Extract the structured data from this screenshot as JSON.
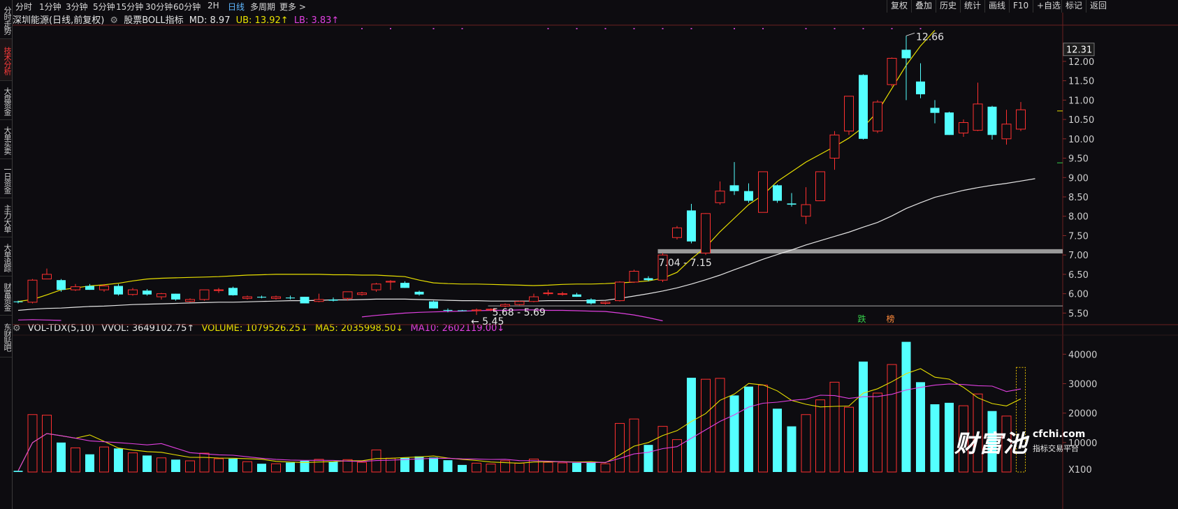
{
  "sidebar": {
    "tabs": [
      {
        "label": "分时走势",
        "active": false
      },
      {
        "label": "技术分析",
        "active": true
      },
      {
        "label": "大盘资金",
        "active": false
      },
      {
        "label": "大单买卖",
        "active": false
      },
      {
        "label": "一日资金",
        "active": false
      },
      {
        "label": "主力大单",
        "active": false
      },
      {
        "label": "大单追踪",
        "active": false
      },
      {
        "label": "财富资金",
        "active": false
      },
      {
        "label": "东财贴吧",
        "active": false
      }
    ]
  },
  "toolbar": {
    "periods": [
      "分时",
      "1分钟",
      "3分钟",
      "5分钟",
      "15分钟",
      "30分钟",
      "60分钟",
      "2H",
      "日线",
      "多周期",
      "更多 >"
    ],
    "active_period": "日线",
    "right_buttons": [
      "复权",
      "叠加",
      "历史",
      "统计",
      "画线",
      "F10",
      "+自选",
      "标记",
      "返回"
    ]
  },
  "indicator_line": {
    "stock": "深圳能源(日线,前复权)",
    "indicator": "股票BOLL指标",
    "md": "MD: 8.97",
    "ub": "UB: 13.92↑",
    "lb": "LB: 3.83↑",
    "colors": {
      "md": "#e6e6e6",
      "ub": "#e8e000",
      "lb": "#e040e0"
    }
  },
  "volume_line": {
    "name": "VOL-TDX(5,10)",
    "vvol": "VVOL: 3649102.75↑",
    "volume": "VOLUME: 1079526.25↓",
    "ma5": "MA5: 2035998.50↓",
    "ma10": "MA10: 2602119.00↓"
  },
  "price_axis": {
    "ticks": [
      "12.00",
      "11.50",
      "11.00",
      "10.50",
      "10.00",
      "9.50",
      "9.00",
      "8.50",
      "8.00",
      "7.50",
      "7.00",
      "6.50",
      "6.00",
      "5.50"
    ],
    "current_price_label": "12.31"
  },
  "volume_axis": {
    "ticks": [
      "40000",
      "30000",
      "20000",
      "10000"
    ],
    "unit": "X100"
  },
  "annotations": {
    "high": "12.66",
    "low": "5.45",
    "gap_top": "7.04 - 7.15",
    "gap_bottom": "5.68 - 5.69",
    "badge_die": "跌",
    "badge_bang": "榜"
  },
  "watermark": {
    "brand": "财富池",
    "site": "cfchi.com",
    "tagline": "指标交易平台"
  },
  "colors": {
    "up": "#ff3030",
    "down": "#54ffff",
    "ma5": "#e8e000",
    "ma10": "#e040e0",
    "bg": "#0d0c10"
  },
  "chart_data": {
    "type": "candlestick",
    "title": "深圳能源(日线,前复权)",
    "ylim": [
      5.2,
      12.9
    ],
    "candles": [
      {
        "o": 5.8,
        "h": 5.82,
        "l": 5.75,
        "c": 5.78,
        "v": 400
      },
      {
        "o": 5.78,
        "h": 6.38,
        "l": 5.75,
        "c": 6.35,
        "v": 19500
      },
      {
        "o": 6.38,
        "h": 6.65,
        "l": 6.38,
        "c": 6.5,
        "v": 19300
      },
      {
        "o": 6.35,
        "h": 6.38,
        "l": 6.05,
        "c": 6.1,
        "v": 10000
      },
      {
        "o": 6.1,
        "h": 6.25,
        "l": 6.07,
        "c": 6.18,
        "v": 8200
      },
      {
        "o": 6.2,
        "h": 6.25,
        "l": 6.1,
        "c": 6.1,
        "v": 6000
      },
      {
        "o": 6.1,
        "h": 6.25,
        "l": 6.05,
        "c": 6.2,
        "v": 8500
      },
      {
        "o": 6.2,
        "h": 6.25,
        "l": 5.95,
        "c": 5.98,
        "v": 8000
      },
      {
        "o": 5.98,
        "h": 6.15,
        "l": 5.95,
        "c": 6.1,
        "v": 6500
      },
      {
        "o": 6.08,
        "h": 6.12,
        "l": 5.95,
        "c": 5.98,
        "v": 5600
      },
      {
        "o": 5.92,
        "h": 6.02,
        "l": 5.85,
        "c": 6.0,
        "v": 4800
      },
      {
        "o": 6.0,
        "h": 6.0,
        "l": 5.82,
        "c": 5.85,
        "v": 4200
      },
      {
        "o": 5.8,
        "h": 5.88,
        "l": 5.78,
        "c": 5.85,
        "v": 3800
      },
      {
        "o": 5.85,
        "h": 6.1,
        "l": 5.82,
        "c": 6.1,
        "v": 6400
      },
      {
        "o": 6.1,
        "h": 6.15,
        "l": 6.02,
        "c": 6.1,
        "v": 4500
      },
      {
        "o": 6.15,
        "h": 6.18,
        "l": 5.95,
        "c": 5.96,
        "v": 4500
      },
      {
        "o": 5.88,
        "h": 5.95,
        "l": 5.85,
        "c": 5.92,
        "v": 3500
      },
      {
        "o": 5.92,
        "h": 5.95,
        "l": 5.88,
        "c": 5.9,
        "v": 2800
      },
      {
        "o": 5.88,
        "h": 5.95,
        "l": 5.85,
        "c": 5.92,
        "v": 2800
      },
      {
        "o": 5.9,
        "h": 5.95,
        "l": 5.85,
        "c": 5.88,
        "v": 3200
      },
      {
        "o": 5.92,
        "h": 5.92,
        "l": 5.75,
        "c": 5.75,
        "v": 3800
      },
      {
        "o": 5.8,
        "h": 6.0,
        "l": 5.78,
        "c": 5.85,
        "v": 4300
      },
      {
        "o": 5.85,
        "h": 5.9,
        "l": 5.8,
        "c": 5.82,
        "v": 3500
      },
      {
        "o": 5.88,
        "h": 6.05,
        "l": 5.82,
        "c": 6.05,
        "v": 4200
      },
      {
        "o": 5.98,
        "h": 6.05,
        "l": 5.95,
        "c": 6.02,
        "v": 3300
      },
      {
        "o": 6.1,
        "h": 6.28,
        "l": 6.05,
        "c": 6.25,
        "v": 7500
      },
      {
        "o": 6.3,
        "h": 6.35,
        "l": 6.1,
        "c": 6.32,
        "v": 4700
      },
      {
        "o": 6.28,
        "h": 6.32,
        "l": 6.15,
        "c": 6.15,
        "v": 4800
      },
      {
        "o": 6.05,
        "h": 6.08,
        "l": 5.95,
        "c": 5.98,
        "v": 5300
      },
      {
        "o": 5.8,
        "h": 5.82,
        "l": 5.62,
        "c": 5.62,
        "v": 4900
      },
      {
        "o": 5.58,
        "h": 5.62,
        "l": 5.52,
        "c": 5.56,
        "v": 4000
      },
      {
        "o": 5.57,
        "h": 5.58,
        "l": 5.55,
        "c": 5.56,
        "v": 2400
      },
      {
        "o": 5.56,
        "h": 5.62,
        "l": 5.45,
        "c": 5.58,
        "v": 3000
      },
      {
        "o": 5.58,
        "h": 5.62,
        "l": 5.55,
        "c": 5.6,
        "v": 2700
      },
      {
        "o": 5.68,
        "h": 5.75,
        "l": 5.65,
        "c": 5.72,
        "v": 3800
      },
      {
        "o": 5.72,
        "h": 5.82,
        "l": 5.7,
        "c": 5.8,
        "v": 3000
      },
      {
        "o": 5.8,
        "h": 6.0,
        "l": 5.78,
        "c": 5.92,
        "v": 4400
      },
      {
        "o": 6.0,
        "h": 6.1,
        "l": 5.95,
        "c": 6.02,
        "v": 3300
      },
      {
        "o": 6.0,
        "h": 6.05,
        "l": 5.95,
        "c": 6.0,
        "v": 3100
      },
      {
        "o": 5.98,
        "h": 6.02,
        "l": 5.92,
        "c": 5.92,
        "v": 3100
      },
      {
        "o": 5.85,
        "h": 5.88,
        "l": 5.72,
        "c": 5.75,
        "v": 3500
      },
      {
        "o": 5.75,
        "h": 5.8,
        "l": 5.72,
        "c": 5.78,
        "v": 2800
      },
      {
        "o": 5.82,
        "h": 6.32,
        "l": 5.8,
        "c": 6.3,
        "v": 16500
      },
      {
        "o": 6.3,
        "h": 6.62,
        "l": 6.28,
        "c": 6.58,
        "v": 18000
      },
      {
        "o": 6.4,
        "h": 6.45,
        "l": 6.32,
        "c": 6.35,
        "v": 9200
      },
      {
        "o": 6.35,
        "h": 7.05,
        "l": 6.3,
        "c": 7.0,
        "v": 15500
      },
      {
        "o": 7.45,
        "h": 7.75,
        "l": 7.4,
        "c": 7.7,
        "v": 11000
      },
      {
        "o": 8.15,
        "h": 8.32,
        "l": 7.3,
        "c": 7.35,
        "v": 32000
      },
      {
        "o": 7.05,
        "h": 8.08,
        "l": 7.0,
        "c": 8.07,
        "v": 31500
      },
      {
        "o": 8.35,
        "h": 8.9,
        "l": 8.3,
        "c": 8.65,
        "v": 31800
      },
      {
        "o": 8.8,
        "h": 9.4,
        "l": 8.55,
        "c": 8.65,
        "v": 26000
      },
      {
        "o": 8.65,
        "h": 8.85,
        "l": 8.35,
        "c": 8.4,
        "v": 29000
      },
      {
        "o": 8.1,
        "h": 9.15,
        "l": 8.1,
        "c": 9.15,
        "v": 29500
      },
      {
        "o": 8.8,
        "h": 8.82,
        "l": 8.35,
        "c": 8.4,
        "v": 21500
      },
      {
        "o": 8.33,
        "h": 8.6,
        "l": 8.25,
        "c": 8.3,
        "v": 15500
      },
      {
        "o": 8.0,
        "h": 8.75,
        "l": 7.8,
        "c": 8.3,
        "v": 19500
      },
      {
        "o": 8.4,
        "h": 9.15,
        "l": 8.4,
        "c": 9.15,
        "v": 24500
      },
      {
        "o": 9.5,
        "h": 10.2,
        "l": 9.2,
        "c": 10.1,
        "v": 30500
      },
      {
        "o": 10.2,
        "h": 11.1,
        "l": 10.1,
        "c": 11.1,
        "v": 22000
      },
      {
        "o": 11.65,
        "h": 11.67,
        "l": 9.98,
        "c": 10.0,
        "v": 37500
      },
      {
        "o": 10.2,
        "h": 11.0,
        "l": 10.15,
        "c": 10.95,
        "v": 26800
      },
      {
        "o": 11.4,
        "h": 12.1,
        "l": 11.35,
        "c": 12.08,
        "v": 36500
      },
      {
        "o": 12.3,
        "h": 12.66,
        "l": 11.0,
        "c": 12.08,
        "v": 44200
      },
      {
        "o": 11.48,
        "h": 11.95,
        "l": 11.05,
        "c": 11.15,
        "v": 30500
      },
      {
        "o": 10.8,
        "h": 11.0,
        "l": 10.4,
        "c": 10.67,
        "v": 23000
      },
      {
        "o": 10.68,
        "h": 10.7,
        "l": 10.1,
        "c": 10.1,
        "v": 23500
      },
      {
        "o": 10.15,
        "h": 10.5,
        "l": 10.05,
        "c": 10.42,
        "v": 22500
      },
      {
        "o": 10.22,
        "h": 11.45,
        "l": 10.2,
        "c": 10.9,
        "v": 26500
      },
      {
        "o": 10.83,
        "h": 10.85,
        "l": 9.98,
        "c": 10.1,
        "v": 20700
      },
      {
        "o": 10.0,
        "h": 10.75,
        "l": 9.85,
        "c": 10.38,
        "v": 19000
      },
      {
        "o": 10.25,
        "h": 10.95,
        "l": 10.2,
        "c": 10.75,
        "v": 35500
      }
    ],
    "boll": {
      "md": [
        5.57,
        5.6,
        5.62,
        5.63,
        5.65,
        5.67,
        5.68,
        5.7,
        5.72,
        5.73,
        5.74,
        5.75,
        5.76,
        5.77,
        5.78,
        5.78,
        5.79,
        5.8,
        5.81,
        5.82,
        5.82,
        5.83,
        5.84,
        5.84,
        5.85,
        5.86,
        5.86,
        5.86,
        5.85,
        5.84,
        5.83,
        5.82,
        5.82,
        5.81,
        5.81,
        5.81,
        5.81,
        5.82,
        5.82,
        5.82,
        5.82,
        5.83,
        5.88,
        5.94,
        6.0,
        6.07,
        6.15,
        6.25,
        6.36,
        6.48,
        6.62,
        6.75,
        6.89,
        7.01,
        7.13,
        7.26,
        7.37,
        7.48,
        7.59,
        7.72,
        7.84,
        8.01,
        8.2,
        8.35,
        8.49,
        8.58,
        8.67,
        8.74,
        8.8,
        8.85,
        8.91,
        8.97
      ],
      "ub": [
        5.8,
        5.85,
        5.97,
        6.1,
        6.15,
        6.2,
        6.23,
        6.27,
        6.33,
        6.38,
        6.4,
        6.41,
        6.42,
        6.43,
        6.44,
        6.46,
        6.48,
        6.49,
        6.5,
        6.5,
        6.5,
        6.5,
        6.49,
        6.49,
        6.48,
        6.48,
        6.46,
        6.44,
        6.35,
        6.28,
        6.26,
        6.25,
        6.25,
        6.24,
        6.23,
        6.22,
        6.21,
        6.22,
        6.24,
        6.25,
        6.25,
        6.26,
        6.28,
        6.3,
        6.33,
        6.4,
        6.55,
        6.9,
        7.2,
        7.6,
        7.95,
        8.3,
        8.55,
        8.9,
        9.15,
        9.4,
        9.6,
        9.8,
        10.02,
        10.3,
        10.7,
        11.3,
        11.9,
        12.4,
        12.8,
        null,
        null,
        null,
        null,
        null,
        null,
        null
      ],
      "lb": [
        5.32,
        5.33,
        5.32,
        5.31,
        null,
        null,
        null,
        null,
        null,
        null,
        null,
        null,
        null,
        null,
        null,
        null,
        null,
        null,
        null,
        null,
        null,
        null,
        null,
        null,
        5.4,
        5.44,
        5.47,
        5.5,
        5.52,
        5.53,
        5.54,
        5.55,
        5.56,
        5.57,
        5.57,
        5.58,
        5.58,
        5.57,
        5.57,
        5.56,
        5.55,
        5.54,
        5.5,
        5.45,
        5.38,
        5.3,
        null,
        null,
        null,
        null,
        null,
        null,
        null,
        null,
        null,
        null,
        null,
        null,
        null,
        null,
        null,
        null,
        null,
        null,
        null,
        null,
        null,
        null,
        null,
        null,
        null,
        null
      ]
    },
    "ylim_volume": [
      0,
      46000
    ]
  }
}
